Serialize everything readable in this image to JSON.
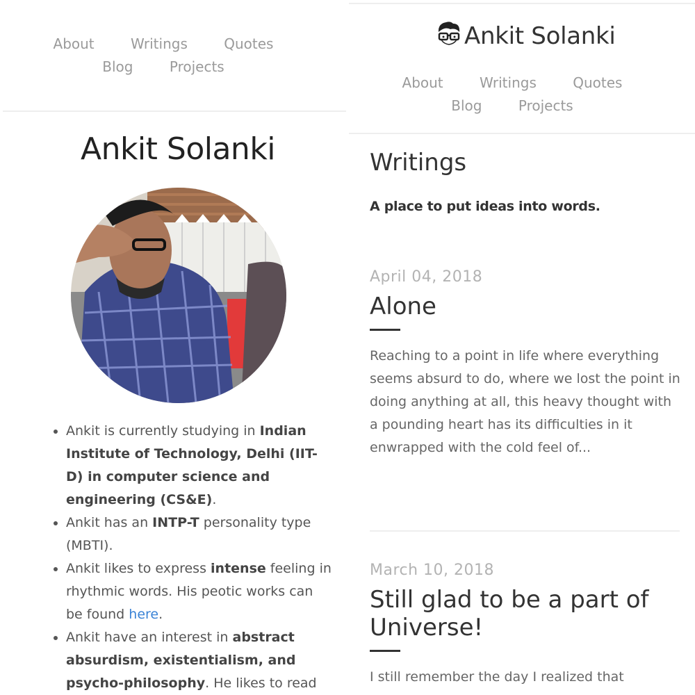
{
  "nav": {
    "items": [
      "About",
      "Writings",
      "Quotes",
      "Blog",
      "Projects"
    ]
  },
  "left": {
    "title": "Ankit Solanki",
    "bio": [
      {
        "pre": "Ankit is currently studying in ",
        "bold": "Indian Institute of Technology, Delhi (IIT-D) in computer science and engineering (CS&E)",
        "post": "."
      },
      {
        "pre": "Ankit has an ",
        "bold": "INTP-T",
        "post": " personality type (MBTI)."
      },
      {
        "pre": "Ankit likes to express ",
        "bold": "intense",
        "post": " feeling in rhythmic words. His peotic works can be found ",
        "link": "here",
        "post2": "."
      },
      {
        "pre": "Ankit have an interest in ",
        "bold": "abstract absurdism, existentialism, and psycho-philosophy",
        "post": ". He likes to read"
      }
    ]
  },
  "right": {
    "brand": "Ankit Solanki",
    "brand_icon": "nerd-glasses-icon",
    "section_title": "Writings",
    "tagline": "A place to put ideas into words.",
    "posts": [
      {
        "date": "April 04, 2018",
        "title": "Alone",
        "excerpt": "Reaching to a point in life where everything seems absurd to do, where we lost the point in doing anything at all, this heavy thought with a pounding heart has its difficulties in it enwrapped with the cold feel of..."
      },
      {
        "date": "March 10, 2018",
        "title": "Still glad to be a part of Universe!",
        "excerpt": "I still remember the day I realized that"
      }
    ]
  },
  "colors": {
    "link": "#3a83d6",
    "nav": "#9a9a9a",
    "date": "#b3b3b3"
  }
}
